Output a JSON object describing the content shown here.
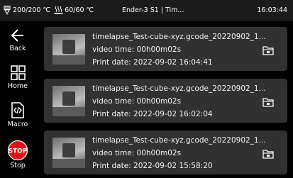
{
  "status_bar": {
    "nozzle_temp": "200/200 ℃",
    "bed_temp": "60/60 ℃",
    "printer_name": "Ender-3 S1 | Tim...",
    "time": "16:03:44"
  },
  "sidebar": {
    "back": "Back",
    "home": "Home",
    "macro": "Macro",
    "stop": "Stop",
    "stop_icon_text": "STOP"
  },
  "timelapses": [
    {
      "filename": "timelapse_Test-cube-xyz.gcode_20220902_1...",
      "video_time": "video time: 00h00m02s",
      "print_date": "Print date: 2022-09-02 16:04:41"
    },
    {
      "filename": "timelapse_Test-cube-xyz.gcode_20220902_1...",
      "video_time": "video time: 00h00m02s",
      "print_date": "Print date: 2022-09-02 16:02:04"
    },
    {
      "filename": "timelapse_Test-cube-xyz.gcode_20220902_1...",
      "video_time": "video time: 00h00m02s",
      "print_date": "Print date: 2022-09-02 15:58:20"
    }
  ],
  "colors": {
    "background": "#000000",
    "card": "#313131",
    "stop_red": "#d8141a"
  }
}
